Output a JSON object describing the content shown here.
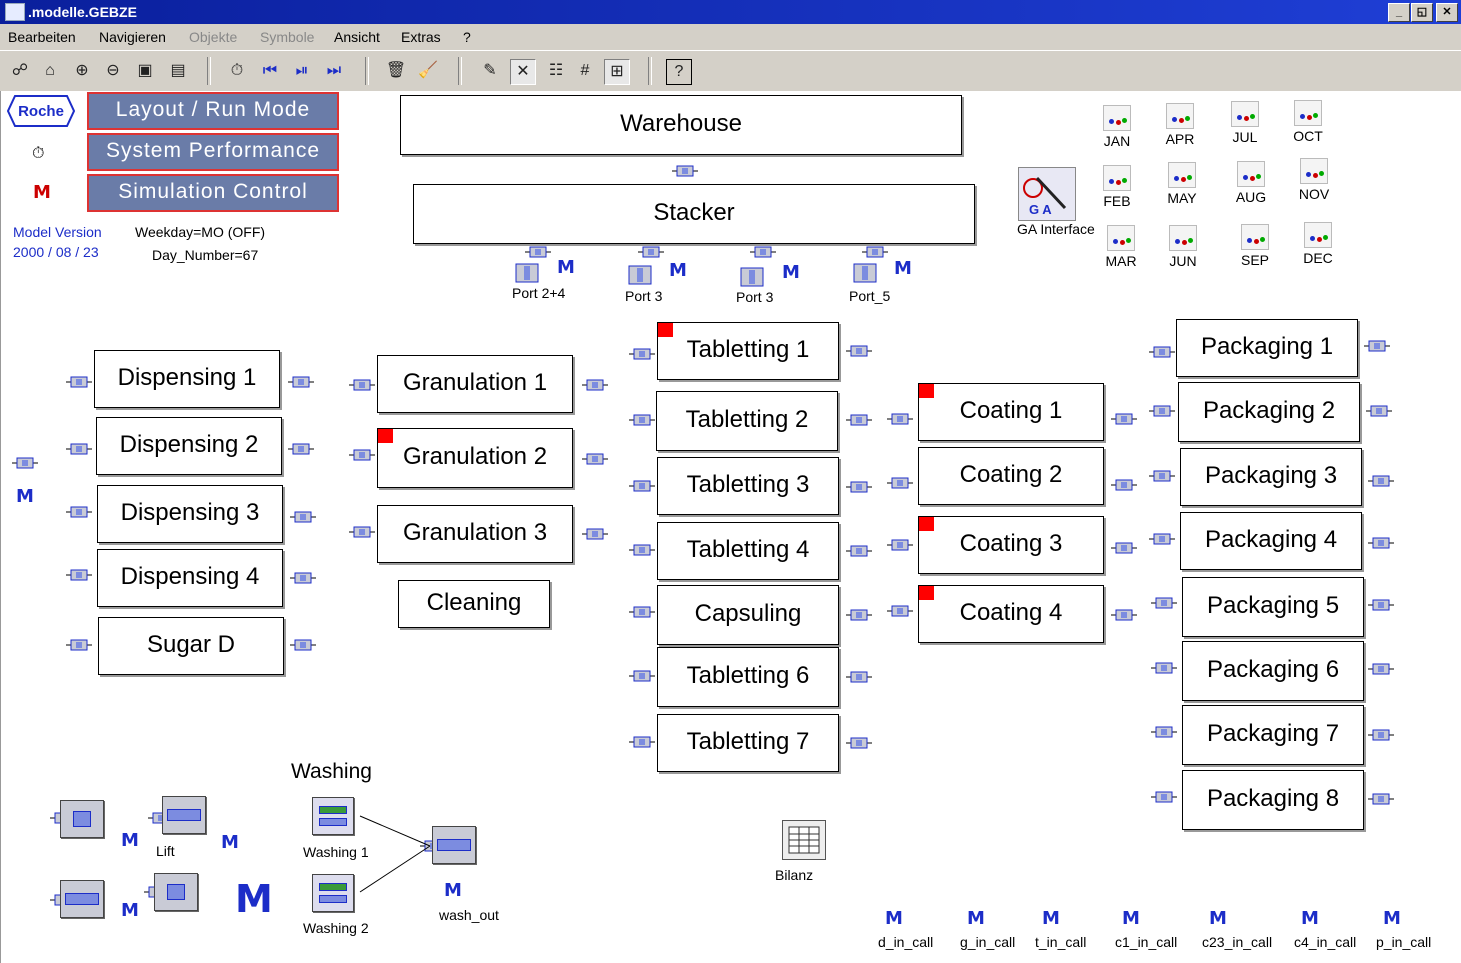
{
  "window": {
    "title": ".modelle.GEBZE",
    "min_btn": "_",
    "max_btn": "◱",
    "close_btn": "✕"
  },
  "menu": [
    {
      "label": "Bearbeiten",
      "enabled": true
    },
    {
      "label": "Navigieren",
      "enabled": true
    },
    {
      "label": "Objekte",
      "enabled": false
    },
    {
      "label": "Symbole",
      "enabled": false
    },
    {
      "label": "Ansicht",
      "enabled": true
    },
    {
      "label": "Extras",
      "enabled": true
    },
    {
      "label": "?",
      "enabled": true
    }
  ],
  "toolbar": {
    "icons": [
      "binoculars-icon",
      "home-icon",
      "zoom-in-icon",
      "zoom-out-icon",
      "fit-icon",
      "frame-icon",
      "stopwatch-icon",
      "rewind-icon",
      "step-icon",
      "fast-forward-icon",
      "trash-icon",
      "broom-icon",
      "eraser-icon",
      "connect-icon",
      "comment-icon",
      "grid-icon",
      "layout-icon",
      "help-icon"
    ],
    "glyphs": [
      "☍",
      "⌂",
      "⊕",
      "⊖",
      "▣",
      "▤",
      "⏱",
      "⏮",
      "⏯",
      "⏭",
      "🗑",
      "🧹",
      "✎",
      "✕",
      "☷",
      "#",
      "⊞",
      "?"
    ]
  },
  "logo": "Roche",
  "nav": {
    "layout": "Layout / Run Mode",
    "system": "System Performance",
    "simulation": "Simulation Control"
  },
  "info": {
    "model_version_label": "Model Version",
    "model_version_date": "2000 / 08 / 23",
    "weekday": "Weekday=MO (OFF)",
    "day_number": "Day_Number=67"
  },
  "warehouse": "Warehouse",
  "stacker": "Stacker",
  "ports": [
    "Port 2+4",
    "Port 3",
    "Port 3",
    "Port_5"
  ],
  "ga_interface": "GA Interface",
  "months": [
    "JAN",
    "APR",
    "JUL",
    "OCT",
    "FEB",
    "MAY",
    "AUG",
    "NOV",
    "MAR",
    "JUN",
    "SEP",
    "DEC"
  ],
  "dispensing": [
    "Dispensing 1",
    "Dispensing 2",
    "Dispensing 3",
    "Dispensing 4",
    "Sugar D"
  ],
  "granulation": [
    "Granulation 1",
    "Granulation 2",
    "Granulation 3"
  ],
  "cleaning": "Cleaning",
  "tabletting": [
    "Tabletting 1",
    "Tabletting 2",
    "Tabletting 3",
    "Tabletting 4",
    "Capsuling",
    "Tabletting 6",
    "Tabletting 7"
  ],
  "coating": [
    "Coating 1",
    "Coating 2",
    "Coating 3",
    "Coating 4"
  ],
  "packaging": [
    "Packaging 1",
    "Packaging 2",
    "Packaging 3",
    "Packaging 4",
    "Packaging 5",
    "Packaging 6",
    "Packaging 7",
    "Packaging 8"
  ],
  "washing": {
    "title": "Washing",
    "w1": "Washing 1",
    "w2": "Washing 2",
    "out": "wash_out"
  },
  "lift": "Lift",
  "bilanz": "Bilanz",
  "methods": [
    "d_in_call",
    "g_in_call",
    "t_in_call",
    "c1_in_call",
    "c23_in_call",
    "c4_in_call",
    "p_in_call"
  ],
  "method_glyph": "M",
  "colors": {
    "title": "#1f3fd6",
    "nav_bg": "#6a7ca8",
    "nav_border": "#d33",
    "flag": "#ff0000",
    "method": "#1c2dc8"
  }
}
